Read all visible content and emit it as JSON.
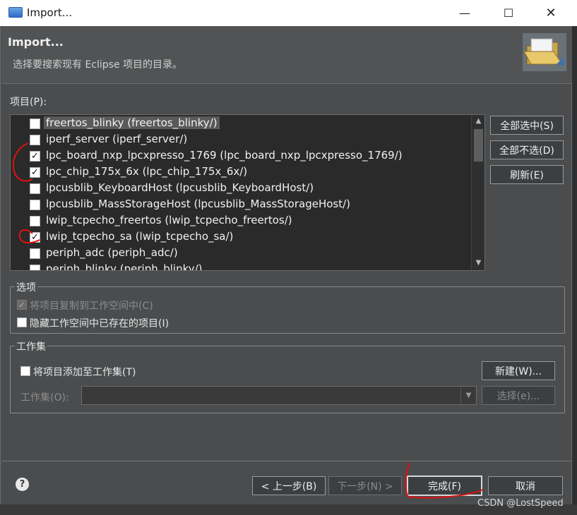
{
  "window": {
    "title": "Import...",
    "min_glyph": "—",
    "max_glyph": "☐",
    "close_glyph": "✕"
  },
  "header": {
    "title": "Import...",
    "description": "选择要搜索现有 Eclipse 项目的目录。",
    "icon": "folder-open-icon"
  },
  "projects": {
    "label": "项目(P):",
    "items": [
      {
        "label": "freertos_blinky  (freertos_blinky/)",
        "checked": false,
        "selected": true
      },
      {
        "label": "iperf_server  (iperf_server/)",
        "checked": false,
        "selected": false
      },
      {
        "label": "lpc_board_nxp_lpcxpresso_1769  (lpc_board_nxp_lpcxpresso_1769/)",
        "checked": true,
        "selected": false
      },
      {
        "label": "lpc_chip_175x_6x  (lpc_chip_175x_6x/)",
        "checked": true,
        "selected": false
      },
      {
        "label": "lpcusblib_KeyboardHost  (lpcusblib_KeyboardHost/)",
        "checked": false,
        "selected": false
      },
      {
        "label": "lpcusblib_MassStorageHost  (lpcusblib_MassStorageHost/)",
        "checked": false,
        "selected": false
      },
      {
        "label": "lwip_tcpecho_freertos  (lwip_tcpecho_freertos/)",
        "checked": false,
        "selected": false
      },
      {
        "label": "lwip_tcpecho_sa  (lwip_tcpecho_sa/)",
        "checked": true,
        "selected": false
      },
      {
        "label": "periph_adc  (periph_adc/)",
        "checked": false,
        "selected": false
      },
      {
        "label": "periph_blinky  (periph_blinky/)",
        "checked": false,
        "selected": false
      }
    ],
    "select_all": "全部选中(S)",
    "deselect_all": "全部不选(D)",
    "refresh": "刷新(E)"
  },
  "options": {
    "legend": "选项",
    "copy_into_workspace": {
      "label": "将项目复制到工作空间中(C)",
      "checked": true,
      "enabled": false
    },
    "hide_existing": {
      "label": "隐藏工作空间中已存在的项目(I)",
      "checked": false,
      "enabled": true
    }
  },
  "working_sets": {
    "legend": "工作集",
    "add_to_working_set": {
      "label": "将项目添加至工作集(T)",
      "checked": false
    },
    "new_button": "新建(W)...",
    "working_set_label": "工作集(O):",
    "working_set_value": "",
    "select_button": "选择(e)..."
  },
  "footer": {
    "back": "< 上一步(B)",
    "next": "下一步(N) >",
    "finish": "完成(F)",
    "cancel": "取消"
  },
  "watermark": "CSDN @LostSpeed",
  "colors": {
    "dialog_bg": "#4a4c4e",
    "list_bg": "#2a2a2a",
    "annotation_red": "#e01010"
  }
}
